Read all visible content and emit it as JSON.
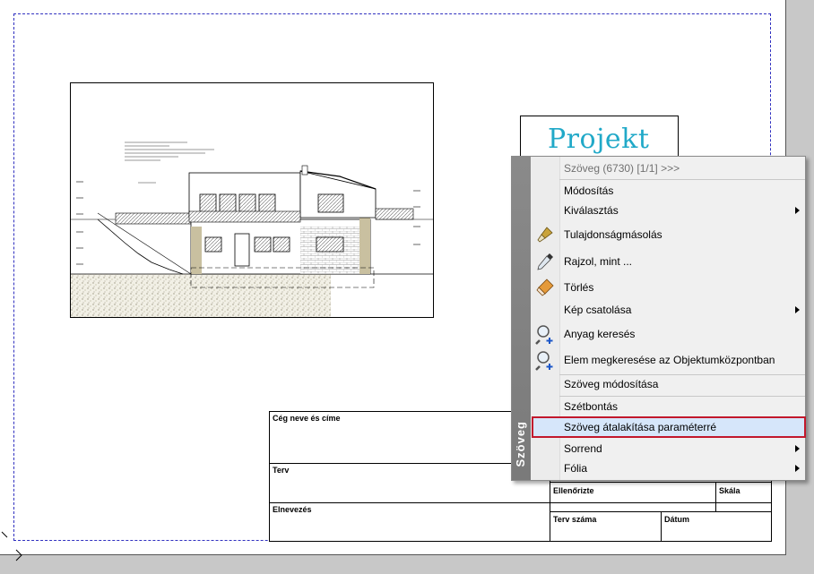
{
  "drawing": {
    "project_label": "Projekt",
    "title_block": {
      "company_label": "Cég neve és címe",
      "plan_label": "Terv",
      "name_label": "Elnevezés",
      "checked_label": "Ellenőrizte",
      "scale_label": "Skála",
      "plan_number_label": "Terv száma",
      "date_label": "Dátum"
    }
  },
  "context_menu": {
    "side_title": "Szöveg",
    "header": "Szöveg (6730) [1/1] >>>",
    "items": [
      {
        "label": "Módosítás",
        "submenu": false
      },
      {
        "label": "Kiválasztás",
        "submenu": true
      },
      {
        "label": "Tulajdonságmásolás",
        "icon": "brush-icon"
      },
      {
        "label": "Rajzol, mint ...",
        "icon": "pipette-icon"
      },
      {
        "label": "Törlés",
        "icon": "eraser-icon"
      },
      {
        "label": "Kép csatolása",
        "submenu": true
      },
      {
        "label": "Anyag keresés",
        "icon": "search-plus-icon"
      },
      {
        "label": "Elem megkeresése az Objektumközpontban",
        "icon": "search-plus-icon"
      },
      {
        "label": "Szöveg módosítása"
      },
      {
        "label": "Szétbontás"
      },
      {
        "label": "Szöveg átalakítása paraméterré",
        "highlighted": true
      },
      {
        "label": "Sorrend",
        "submenu": true
      },
      {
        "label": "Fólia",
        "submenu": true
      }
    ]
  },
  "colors": {
    "project_text": "#21a9c8",
    "highlight_border": "#c2182c",
    "highlight_fill": "#d6e6fa",
    "print_area": "#3030c0"
  }
}
